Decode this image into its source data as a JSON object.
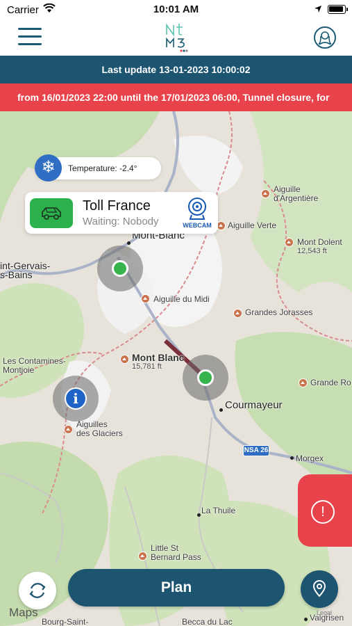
{
  "status_bar": {
    "carrier": "Carrier",
    "time": "10:01 AM"
  },
  "header": {
    "logo_text": "nt m3"
  },
  "update_bar": {
    "text": "Last update 13-01-2023 10:00:02"
  },
  "alert_bar": {
    "text": "from 16/01/2023 22:00 until the 17/01/2023 06:00, Tunnel closure, for"
  },
  "temperature": {
    "text": "Temperature: -2.4°"
  },
  "toll_card": {
    "title": "Toll France",
    "waiting": "Waiting: Nobody",
    "webcam_label": "WEBCAM"
  },
  "map": {
    "places": {
      "aiguille_argentiere": "Aiguille\nd'Argentière",
      "aiguille_verte": "Aiguille Verte",
      "mont_blanc_town": "Mont-Blanc",
      "mont_dolent": "Mont Dolent",
      "mont_dolent_alt": "12,543 ft",
      "saint_gervais": "int-Gervais-\ns-Bains",
      "aiguille_du_midi": "Aiguille du Midi",
      "grandes_jorasses": "Grandes Jorasses",
      "mont_blanc": "Mont Blanc",
      "mont_blanc_alt": "15,781 ft",
      "les_contamines": "Les Contamines-\nMontjoie",
      "grande_ro": "Grande Ro",
      "courmayeur": "Courmayeur",
      "aiguilles_glaciers": "Aiguilles\ndes Glaciers",
      "morgex": "Morgex",
      "la_thuile": "La Thuile",
      "little_st_bernard": "Little St\nBernard Pass",
      "bourg_saint": "Bourg-Saint-",
      "becca_du_lac": "Becca du Lac",
      "valgrisen": "Valgrisen"
    },
    "road_shield": "NSA 26",
    "apple_maps": "Maps",
    "legal": "Legal"
  },
  "buttons": {
    "plan": "Plan"
  },
  "colors": {
    "brand": "#1d5470",
    "alert": "#e8424a",
    "marker_green": "#36b34b",
    "info_blue": "#1f63c6"
  }
}
